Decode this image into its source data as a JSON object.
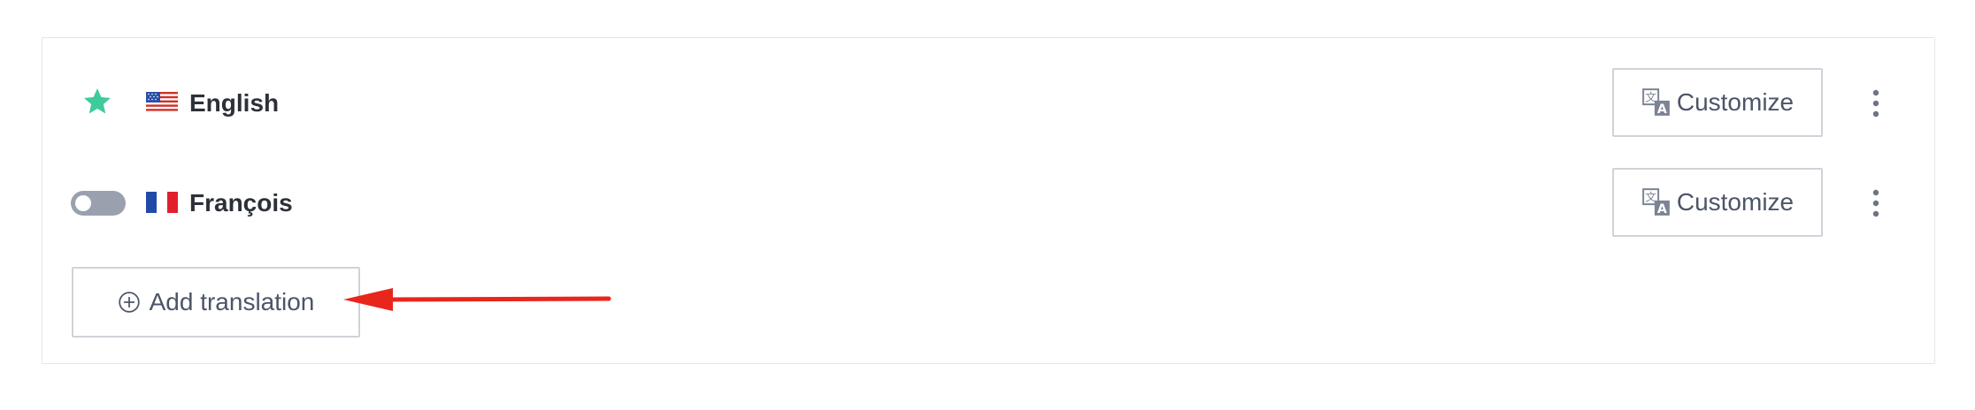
{
  "languages": [
    {
      "name": "English",
      "flag_icon": "us-flag-icon",
      "default_marker_icon": "star-icon",
      "customize_label": "Customize",
      "menu_icon": "kebab-menu-icon"
    },
    {
      "name": "François",
      "flag_icon": "fr-flag-icon",
      "enabled": false,
      "customize_label": "Customize",
      "menu_icon": "kebab-menu-icon"
    }
  ],
  "add_translation": {
    "label": "Add translation",
    "icon": "plus-circle-icon"
  },
  "colors": {
    "accent_green": "#3ecb9a",
    "annotation_red": "#e8261c",
    "text_dark": "#2c3038",
    "text_muted": "#4c5568",
    "border": "#cfd3d9"
  }
}
